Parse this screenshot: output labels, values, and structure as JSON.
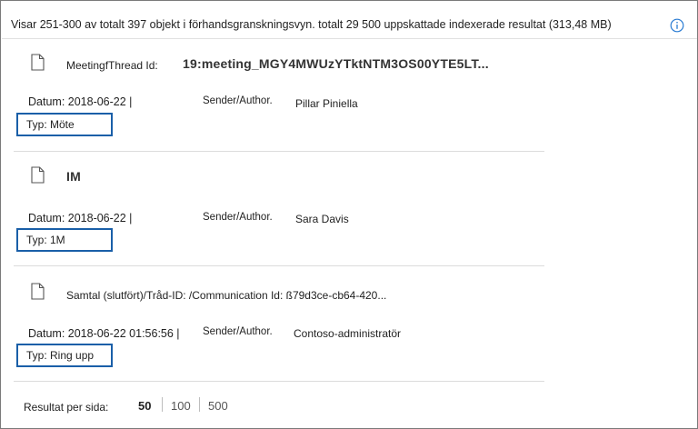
{
  "summary": "Visar 251-300 av totalt 397 objekt i förhandsgranskningsvyn. totalt 29 500 uppskattade indexerade resultat (313,48 MB)",
  "icons": {
    "info": "info-icon",
    "document": "document-icon"
  },
  "results": [
    {
      "subject_label": "MeetingfThread Id:",
      "subject_value": "19:meeting_MGY4MWUzYTktNTM3OS00YTE5LT...",
      "date": "Datum: 2018-06-22 |",
      "sender_label": "Sender/Author.",
      "sender": "Pillar Piniella",
      "type": "Typ: Möte"
    },
    {
      "subject_label": "",
      "subject_value": "IM",
      "date": "Datum: 2018-06-22 |",
      "sender_label": "Sender/Author.",
      "sender": "Sara Davis",
      "type": "Typ: 1M"
    },
    {
      "subject_label": "Samtal (slutfört)/Tråd-ID: /Communication Id: ß79d3ce-cb64-420...",
      "subject_value": "",
      "date": "Datum: 2018-06-22 01:56:56 |",
      "sender_label": "Sender/Author.",
      "sender": "Contoso-administratör",
      "type": "Typ: Ring upp"
    }
  ],
  "pagination": {
    "label": "Resultat per sida:",
    "options": [
      "50",
      "100",
      "500"
    ],
    "selected": "50"
  },
  "colors": {
    "highlight_border": "#1a5fa8",
    "info_icon": "#2b7cd3"
  }
}
